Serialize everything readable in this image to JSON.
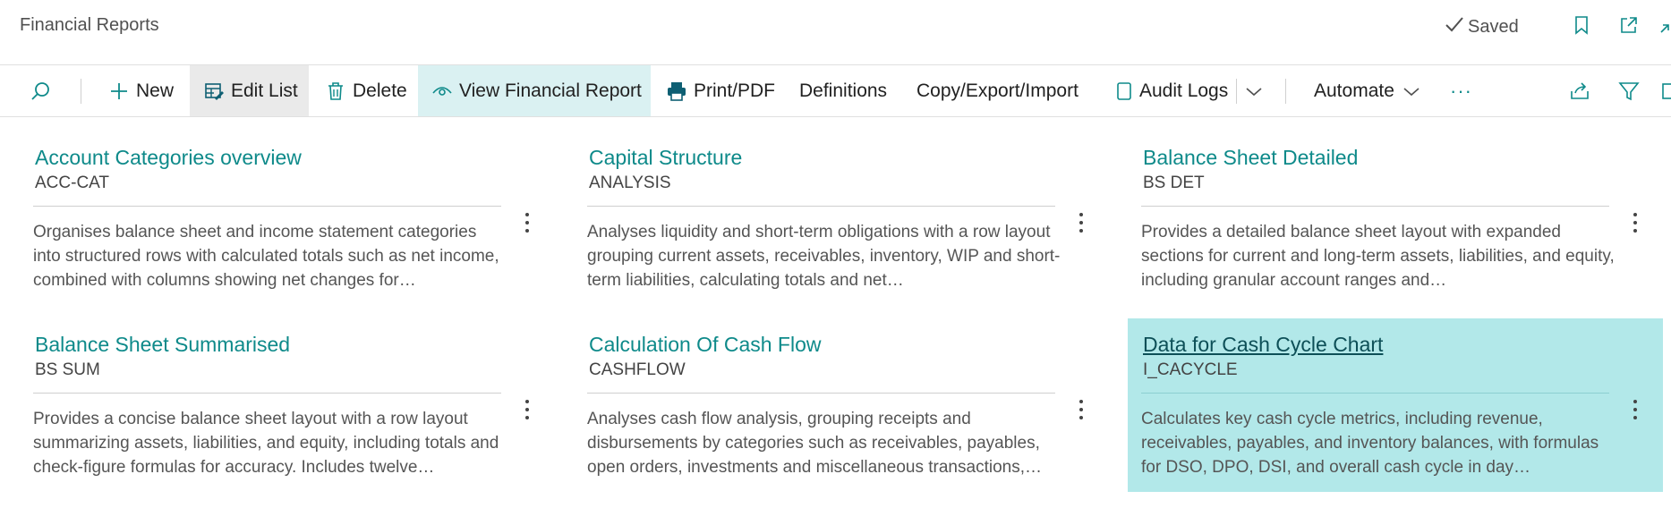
{
  "header": {
    "title": "Financial Reports",
    "saved_label": "Saved",
    "icons": [
      "bookmark-icon",
      "open-new-window-icon",
      "collapse-icon"
    ]
  },
  "actions": {
    "search_icon": "search-icon",
    "new": "New",
    "edit_list": "Edit List",
    "delete": "Delete",
    "view_report": "View Financial Report",
    "print": "Print/PDF",
    "definitions": "Definitions",
    "copy_export": "Copy/Export/Import",
    "audit_logs": "Audit Logs",
    "automate": "Automate",
    "more": "···"
  },
  "colors": {
    "accent": "#0e8a8a",
    "selected_card": "#b2e8e9",
    "highlight_action": "#daf1f2"
  },
  "reports": [
    {
      "title": "Account Categories overview",
      "code": "ACC-CAT",
      "description": "Organises balance sheet and income statement categories into structured rows with calculated totals such as net income, combined with columns showing net changes for…",
      "selected": false
    },
    {
      "title": "Capital Structure",
      "code": "ANALYSIS",
      "description": "Analyses liquidity and short-term obligations with a row layout grouping current assets, receivables, inventory, WIP and short-term liabilities, calculating totals and net…",
      "selected": false
    },
    {
      "title": "Balance Sheet Detailed",
      "code": "BS DET",
      "description": "Provides a detailed balance sheet layout with expanded sections for current and long-term assets, liabilities, and equity, including granular account ranges and…",
      "selected": false
    },
    {
      "title": "Balance Sheet Summarised",
      "code": "BS SUM",
      "description": "Provides a concise balance sheet layout with a row layout summarizing assets, liabilities, and equity, including totals and check-figure formulas for accuracy. Includes twelve…",
      "selected": false
    },
    {
      "title": "Calculation Of Cash Flow",
      "code": "CASHFLOW",
      "description": "Analyses cash flow analysis, grouping receipts and disbursements by categories such as receivables, payables, open orders, investments and miscellaneous transactions,…",
      "selected": false
    },
    {
      "title": "Data for Cash Cycle Chart",
      "code": "I_CACYCLE",
      "description": "Calculates key cash cycle metrics, including revenue, receivables, payables, and inventory balances, with formulas for DSO, DPO, DSI, and overall cash cycle in day…",
      "selected": true
    }
  ]
}
